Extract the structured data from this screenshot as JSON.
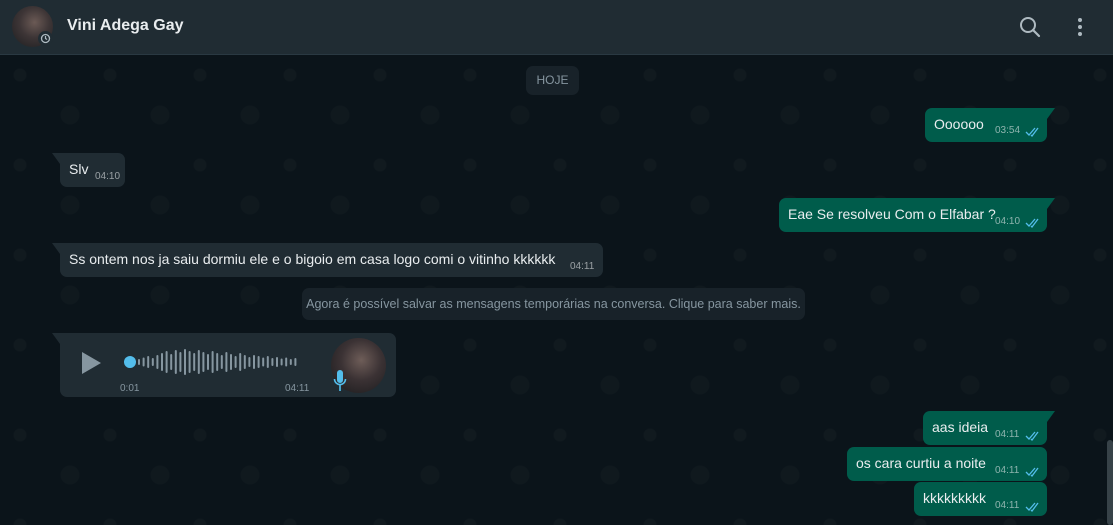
{
  "header": {
    "contact_name": "Vini Adega Gay",
    "icons": [
      "search-icon",
      "menu-icon"
    ]
  },
  "chat": {
    "day_label": "HOJE",
    "notice": "Agora é possível salvar as mensagens temporárias na conversa. Clique para saber mais.",
    "messages": [
      {
        "direction": "out",
        "text": "Oooooo",
        "time": "03:54",
        "status": "read"
      },
      {
        "direction": "in",
        "text": "Slv",
        "time": "04:10"
      },
      {
        "direction": "out",
        "text": "Eae Se resolveu Com o Elfabar ?",
        "time": "04:10",
        "status": "read"
      },
      {
        "direction": "in",
        "text": "Ss ontem nos ja saiu dormiu ele e o bigoio em casa logo comi o vitinho kkkkkk",
        "time": "04:11"
      },
      {
        "direction": "out",
        "text": "aas ideia",
        "time": "04:11",
        "status": "read"
      },
      {
        "direction": "out",
        "text": "os cara curtiu a noite",
        "time": "04:11",
        "status": "read"
      },
      {
        "direction": "out",
        "text": "kkkkkkkkk",
        "time": "04:11",
        "status": "read"
      }
    ],
    "voice_message": {
      "direction": "in",
      "duration": "0:01",
      "time": "04:11",
      "progress": 0
    }
  },
  "colors": {
    "background": "#0b141a",
    "header": "#202c33",
    "outgoing_bubble": "#005c4b",
    "incoming_bubble": "#202c33",
    "read_ticks": "#53bdeb",
    "accent": "#53bdeb"
  }
}
